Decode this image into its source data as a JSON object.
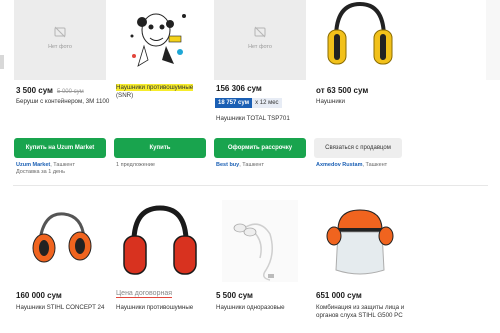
{
  "row1": [
    {
      "nophoto": "Нет фото",
      "price": "3 500 сум",
      "old_price": "5 000 сум",
      "title": "Беруши с контейнером, 3M 1100",
      "button": "Купить на Uzum Market",
      "seller_name": "Uzum Market",
      "seller_city": ", Ташкент",
      "seller_extra": "Доставка за 1 день"
    },
    {
      "price": "",
      "title1": "Наушники противошумные",
      "title2": "(SNR)",
      "button": "Купить",
      "seller_line": "1 предложение"
    },
    {
      "nophoto": "Нет фото",
      "price": "156 306 сум",
      "credit_price": "18 757 сум",
      "credit_term": "x 12 мес",
      "title": "Наушники TOTAL TSP701",
      "button": "Оформить рассрочку",
      "seller_name": "Best buy",
      "seller_city": ", Ташкент"
    },
    {
      "price": "от 63 500 сум",
      "title": "Наушники",
      "button": "Связаться с продавцом",
      "seller_name": "Axmedov Rustam",
      "seller_city": ", Ташкент"
    }
  ],
  "row2": [
    {
      "price": "160 000 сум",
      "title": "Наушники STIHL CONCEPT 24"
    },
    {
      "price": "Цена договорная",
      "title": "Наушники противошумные"
    },
    {
      "price": "5 500 сум",
      "title": "Наушники одноразовые"
    },
    {
      "price": "651 000 сум",
      "title1": "Комбинация из защиты лица и",
      "title2": "органов слуха STIHL G500 PC"
    }
  ]
}
